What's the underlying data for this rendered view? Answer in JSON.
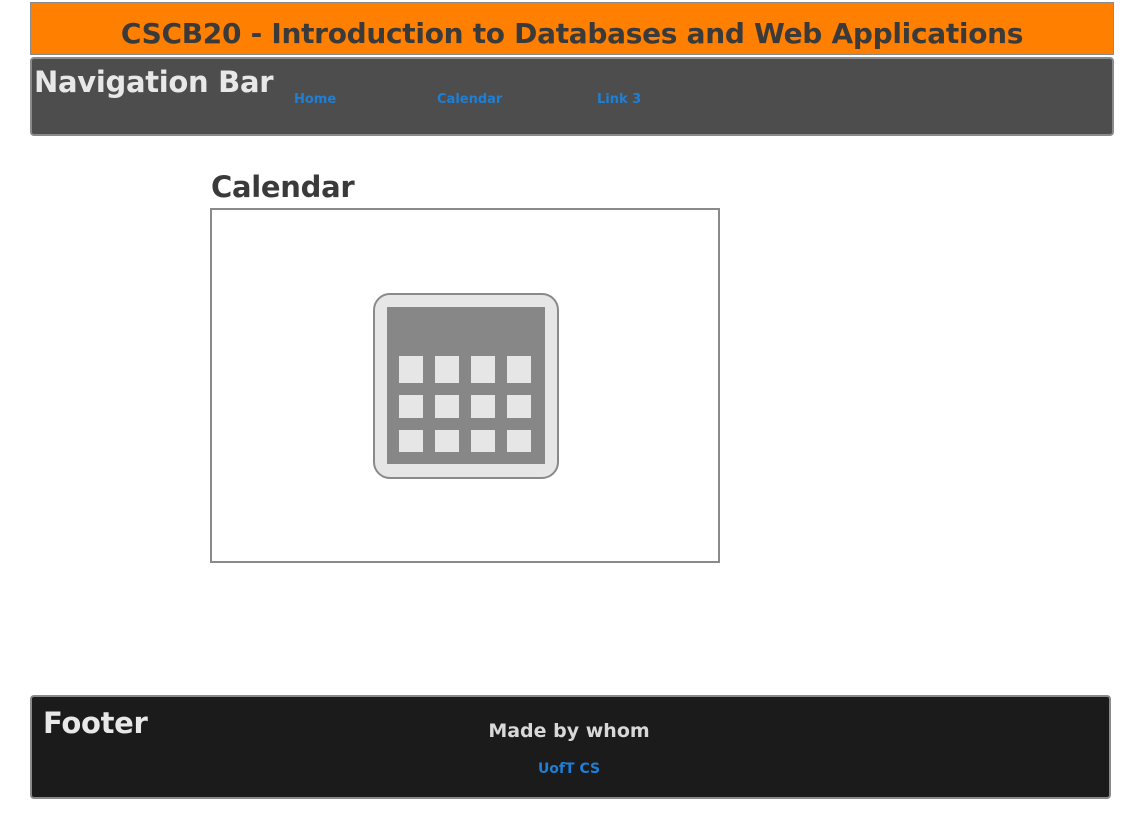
{
  "header": {
    "title": "CSCB20 - Introduction to Databases and Web Applications"
  },
  "navbar": {
    "title": "Navigation Bar",
    "links": [
      {
        "label": "Home"
      },
      {
        "label": "Calendar"
      },
      {
        "label": "Link 3"
      }
    ]
  },
  "main": {
    "title": "Calendar",
    "image_icon": "calendar-icon"
  },
  "footer": {
    "title": "Footer",
    "made_by": "Made by whom",
    "link_label": "UofT CS"
  },
  "colors": {
    "header_bg": "#ff7f00",
    "navbar_bg": "#4d4d4d",
    "footer_bg": "#1b1b1b",
    "link": "#1e7fd6",
    "text_dark": "#3a3a3a"
  }
}
